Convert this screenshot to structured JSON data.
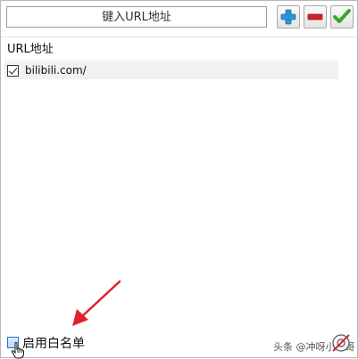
{
  "toolbar": {
    "url_placeholder": "键入URL地址",
    "add_icon": "plus-icon",
    "remove_icon": "minus-icon",
    "confirm_icon": "checkmark-icon",
    "colors": {
      "add": "#2f95d8",
      "remove": "#d2232a",
      "confirm": "#3aa629"
    }
  },
  "list": {
    "header": "URL地址",
    "items": [
      {
        "checked": true,
        "url": "bilibili.com/"
      }
    ]
  },
  "footer": {
    "whitelist_label": "启用白名单",
    "whitelist_checked": false,
    "watermark": "头条 @冲呀小二哥",
    "help_icon": "help-icon",
    "arrow_color": "#e0202a"
  }
}
